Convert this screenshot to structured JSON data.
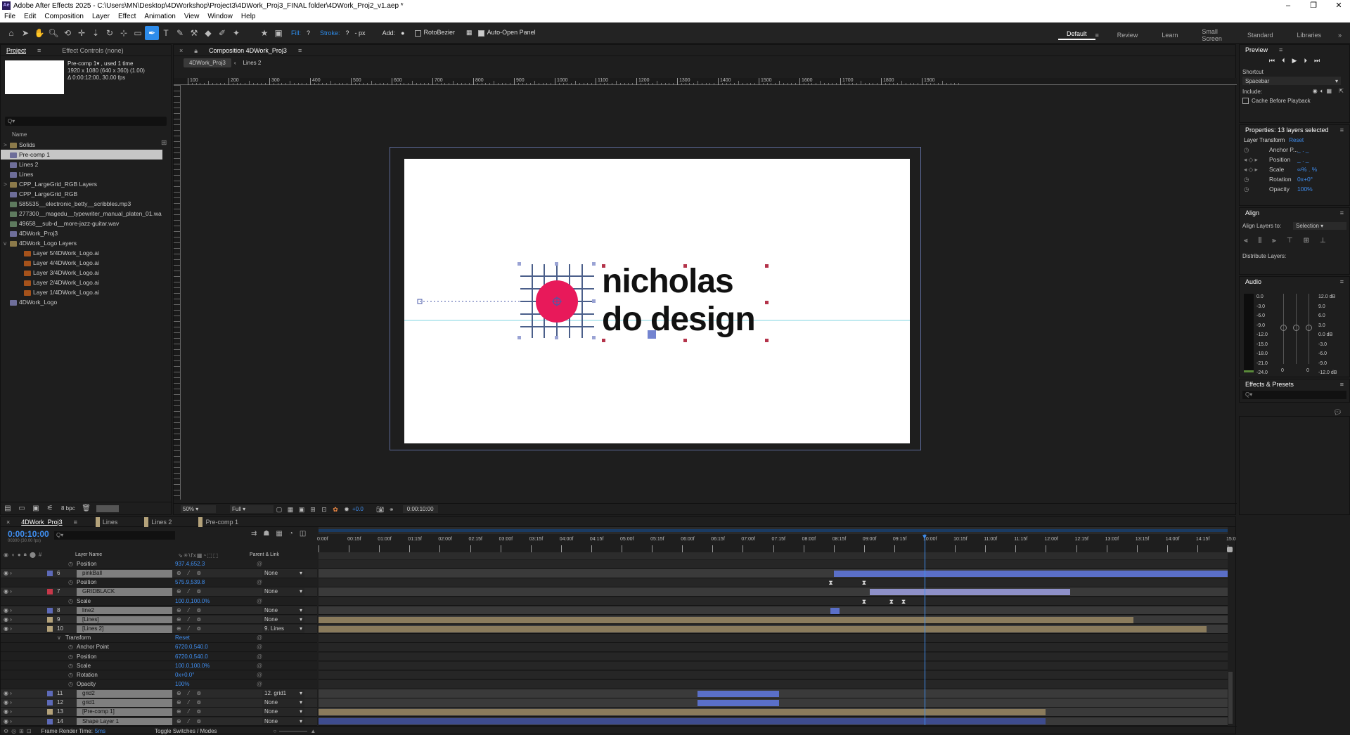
{
  "app": {
    "title": "Adobe After Effects 2025 - C:\\Users\\MN\\Desktop\\4DWorkshop\\Project3\\4DWork_Proj3_FINAL folder\\4DWork_Proj2_v1.aep *",
    "logo": "Ae"
  },
  "menu": [
    "File",
    "Edit",
    "Composition",
    "Layer",
    "Effect",
    "Animation",
    "View",
    "Window",
    "Help"
  ],
  "toolbar": {
    "fill_label": "Fill:",
    "fill_value": "?",
    "stroke_label": "Stroke:",
    "stroke_value": "?",
    "stroke_px": "- px",
    "add_label": "Add:",
    "rotobezier": "RotoBezier",
    "auto_open": "Auto-Open Panel",
    "workspaces": [
      "Default",
      "Review",
      "Learn",
      "Small Screen",
      "Standard",
      "Libraries"
    ]
  },
  "project": {
    "tabs": [
      "Project",
      "Effect Controls (none)"
    ],
    "selected_name": "Pre-comp 1▾ , used 1 time",
    "selected_dims": "1920 x 1080 (640 x 360) (1.00)",
    "selected_duration": "Δ 0:00:12:00, 30.00 fps",
    "search_placeholder": "Q▾",
    "col_name": "Name",
    "items": [
      {
        "name": "Solids",
        "type": "folder",
        "indent": 0,
        "twirl": ">"
      },
      {
        "name": "Pre-comp 1",
        "type": "comp",
        "indent": 0,
        "selected": true
      },
      {
        "name": "Lines 2",
        "type": "comp",
        "indent": 0
      },
      {
        "name": "Lines",
        "type": "comp",
        "indent": 0
      },
      {
        "name": "CPP_LargeGrid_RGB Layers",
        "type": "folder",
        "indent": 0,
        "twirl": ">"
      },
      {
        "name": "CPP_LargeGrid_RGB",
        "type": "comp",
        "indent": 0
      },
      {
        "name": "585535__electronic_betty__scribbles.mp3",
        "type": "audio",
        "indent": 0
      },
      {
        "name": "277300__magedu__typewriter_manual_platen_01.wa",
        "type": "audio",
        "indent": 0
      },
      {
        "name": "49658__sub-d__more-jazz-guitar.wav",
        "type": "audio",
        "indent": 0
      },
      {
        "name": "4DWork_Proj3",
        "type": "comp",
        "indent": 0
      },
      {
        "name": "4DWork_Logo Layers",
        "type": "folder",
        "indent": 0,
        "twirl": "v"
      },
      {
        "name": "Layer 5/4DWork_Logo.ai",
        "type": "ai",
        "indent": 1
      },
      {
        "name": "Layer 4/4DWork_Logo.ai",
        "type": "ai",
        "indent": 1
      },
      {
        "name": "Layer 3/4DWork_Logo.ai",
        "type": "ai",
        "indent": 1
      },
      {
        "name": "Layer 2/4DWork_Logo.ai",
        "type": "ai",
        "indent": 1
      },
      {
        "name": "Layer 1/4DWork_Logo.ai",
        "type": "ai",
        "indent": 1
      },
      {
        "name": "4DWork_Logo",
        "type": "comp",
        "indent": 0
      }
    ],
    "bpc": "8 bpc"
  },
  "comp": {
    "panel_title": "Composition 4DWork_Proj3",
    "tabs": [
      "4DWork_Proj3",
      "Lines 2"
    ],
    "ruler": [
      "100",
      "200",
      "300",
      "400",
      "500",
      "600",
      "700",
      "800",
      "900",
      "1000",
      "1100",
      "1200",
      "1300",
      "1400",
      "1500",
      "1600",
      "1700",
      "1800",
      "1900"
    ],
    "logo_line1": "nicholas",
    "logo_line2": "do design",
    "accent_color": "#e8195a",
    "zoom": "50%",
    "resolution": "Full",
    "exposure": "+0.0",
    "timecode": "0:00:10:00"
  },
  "preview": {
    "title": "Preview",
    "shortcut_label": "Shortcut",
    "shortcut_value": "Spacebar",
    "include_label": "Include:",
    "cache_label": "Cache Before Playback"
  },
  "properties": {
    "title": "Properties: 13 layers selected",
    "section": "Layer Transform",
    "reset": "Reset",
    "rows": [
      {
        "label": "Anchor P...",
        "value": "_ . _"
      },
      {
        "label": "Position",
        "value": "_ . _"
      },
      {
        "label": "Scale",
        "value": "∞% . %"
      },
      {
        "label": "Rotation",
        "value": "0x+0°"
      },
      {
        "label": "Opacity",
        "value": "100%"
      }
    ]
  },
  "align": {
    "title": "Align",
    "align_to_label": "Align Layers to:",
    "align_to_value": "Selection",
    "distribute_label": "Distribute Layers:"
  },
  "audio": {
    "title": "Audio",
    "left_scale": [
      "0.0",
      "-3.0",
      "-6.0",
      "-9.0",
      "-12.0",
      "-15.0",
      "-18.0",
      "-21.0",
      "-24.0"
    ],
    "right_scale": [
      "12.0 dB",
      "9.0",
      "6.0",
      "3.0",
      "0.0 dB",
      "-3.0",
      "-6.0",
      "-9.0",
      "-12.0 dB"
    ],
    "zero_a": "0",
    "zero_b": "0"
  },
  "effects": {
    "title": "Effects & Presets",
    "search_placeholder": "Q▾"
  },
  "timeline": {
    "tabs": [
      "4DWork_Proj3",
      "Lines",
      "Lines 2",
      "Pre-comp 1"
    ],
    "timecode": "0:00:10:00",
    "sub_timecode": "00300 (30.00 fps)",
    "col_layer": "Layer Name",
    "col_parent": "Parent & Link",
    "ruler": [
      "0:00f",
      "00:15f",
      "01:00f",
      "01:15f",
      "02:00f",
      "02:15f",
      "03:00f",
      "03:15f",
      "04:00f",
      "04:15f",
      "05:00f",
      "05:15f",
      "06:00f",
      "06:15f",
      "07:00f",
      "07:15f",
      "08:00f",
      "08:15f",
      "09:00f",
      "09:15f",
      "10:00f",
      "10:15f",
      "11:00f",
      "11:15f",
      "12:00f",
      "12:15f",
      "13:00f",
      "13:15f",
      "14:00f",
      "14:15f",
      "15:0"
    ],
    "playhead_sec": 10,
    "duration_sec": 15,
    "rows": [
      {
        "kind": "prop",
        "name": "Position",
        "value": "937.4,652.3"
      },
      {
        "kind": "layer",
        "num": "6",
        "name": "pinkBall",
        "color": "#5d6ab8",
        "parent": "None",
        "bar": [
          8.5,
          15
        ],
        "barColor": "#5a6fc8"
      },
      {
        "kind": "prop",
        "name": "Position",
        "value": "575.9,539.8",
        "keys": [
          8.45,
          9.0
        ]
      },
      {
        "kind": "layer",
        "num": "7",
        "name": "GRIDBLACK",
        "color": "#c8384a",
        "parent": "None",
        "bar": [
          9.1,
          12.4
        ],
        "barColor": "#8e90c8"
      },
      {
        "kind": "prop",
        "name": "Scale",
        "value": "100.0,100.0%",
        "keys": [
          9.0,
          9.45,
          9.65
        ]
      },
      {
        "kind": "layer",
        "num": "8",
        "name": "line2",
        "color": "#5d6ab8",
        "parent": "None",
        "bar": [
          8.45,
          8.6
        ],
        "barColor": "#5a6fc8"
      },
      {
        "kind": "layer",
        "num": "9",
        "name": "[Lines]",
        "color": "#b4a27a",
        "parent": "None",
        "bar": [
          0,
          13.45
        ],
        "barColor": "#8a7b5c"
      },
      {
        "kind": "layer",
        "num": "10",
        "name": "[Lines 2]",
        "color": "#b4a27a",
        "parent": "9. Lines",
        "bar": [
          0,
          14.65
        ],
        "barColor": "#8a7b5c"
      },
      {
        "kind": "group",
        "name": "Transform",
        "value": "Reset"
      },
      {
        "kind": "prop",
        "name": "Anchor Point",
        "value": "6720.0,540.0"
      },
      {
        "kind": "prop",
        "name": "Position",
        "value": "6720.0,540.0"
      },
      {
        "kind": "prop",
        "name": "Scale",
        "value": "100.0,100.0%"
      },
      {
        "kind": "prop",
        "name": "Rotation",
        "value": "0x+0.0°"
      },
      {
        "kind": "prop",
        "name": "Opacity",
        "value": "100%"
      },
      {
        "kind": "layer",
        "num": "11",
        "name": "grid2",
        "color": "#5d6ab8",
        "parent": "12. grid1",
        "bar": [
          6.25,
          7.6
        ],
        "barColor": "#5a6fc8"
      },
      {
        "kind": "layer",
        "num": "12",
        "name": "grid1",
        "color": "#5d6ab8",
        "parent": "None",
        "bar": [
          6.25,
          7.6
        ],
        "barColor": "#5a6fc8"
      },
      {
        "kind": "layer",
        "num": "13",
        "name": "[Pre-comp 1]",
        "color": "#b4a27a",
        "parent": "None",
        "bar": [
          0,
          12.0
        ],
        "barColor": "#8a7b5c"
      },
      {
        "kind": "layer",
        "num": "14",
        "name": "Shape Layer 1",
        "color": "#5d6ab8",
        "parent": "None",
        "bar": [
          0,
          12.0
        ],
        "barColor": "#3e4c8e"
      }
    ],
    "frame_render_label": "Frame Render Time:",
    "frame_render_value": "5ms",
    "toggle_label": "Toggle Switches / Modes"
  }
}
